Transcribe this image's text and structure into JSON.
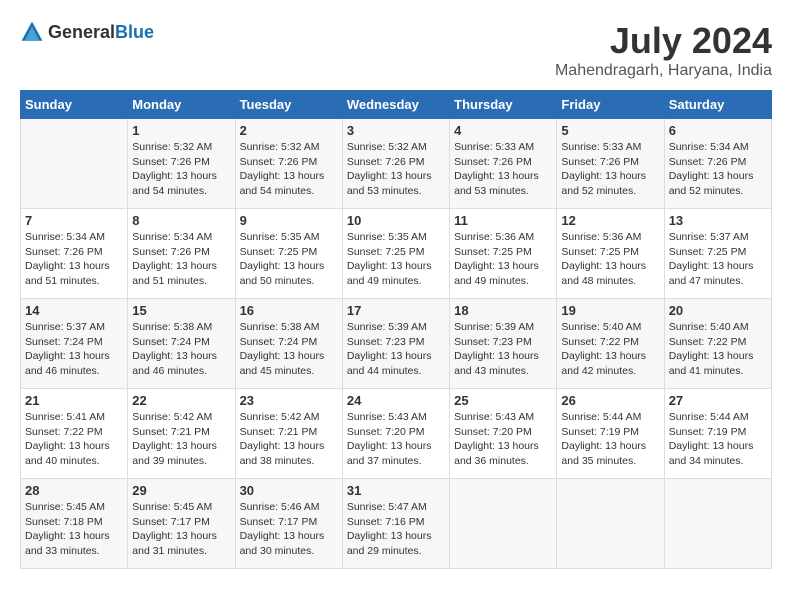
{
  "header": {
    "logo_general": "General",
    "logo_blue": "Blue",
    "month_year": "July 2024",
    "location": "Mahendragarh, Haryana, India"
  },
  "weekdays": [
    "Sunday",
    "Monday",
    "Tuesday",
    "Wednesday",
    "Thursday",
    "Friday",
    "Saturday"
  ],
  "weeks": [
    [
      {
        "day": "",
        "info": ""
      },
      {
        "day": "1",
        "info": "Sunrise: 5:32 AM\nSunset: 7:26 PM\nDaylight: 13 hours\nand 54 minutes."
      },
      {
        "day": "2",
        "info": "Sunrise: 5:32 AM\nSunset: 7:26 PM\nDaylight: 13 hours\nand 54 minutes."
      },
      {
        "day": "3",
        "info": "Sunrise: 5:32 AM\nSunset: 7:26 PM\nDaylight: 13 hours\nand 53 minutes."
      },
      {
        "day": "4",
        "info": "Sunrise: 5:33 AM\nSunset: 7:26 PM\nDaylight: 13 hours\nand 53 minutes."
      },
      {
        "day": "5",
        "info": "Sunrise: 5:33 AM\nSunset: 7:26 PM\nDaylight: 13 hours\nand 52 minutes."
      },
      {
        "day": "6",
        "info": "Sunrise: 5:34 AM\nSunset: 7:26 PM\nDaylight: 13 hours\nand 52 minutes."
      }
    ],
    [
      {
        "day": "7",
        "info": "Sunrise: 5:34 AM\nSunset: 7:26 PM\nDaylight: 13 hours\nand 51 minutes."
      },
      {
        "day": "8",
        "info": "Sunrise: 5:34 AM\nSunset: 7:26 PM\nDaylight: 13 hours\nand 51 minutes."
      },
      {
        "day": "9",
        "info": "Sunrise: 5:35 AM\nSunset: 7:25 PM\nDaylight: 13 hours\nand 50 minutes."
      },
      {
        "day": "10",
        "info": "Sunrise: 5:35 AM\nSunset: 7:25 PM\nDaylight: 13 hours\nand 49 minutes."
      },
      {
        "day": "11",
        "info": "Sunrise: 5:36 AM\nSunset: 7:25 PM\nDaylight: 13 hours\nand 49 minutes."
      },
      {
        "day": "12",
        "info": "Sunrise: 5:36 AM\nSunset: 7:25 PM\nDaylight: 13 hours\nand 48 minutes."
      },
      {
        "day": "13",
        "info": "Sunrise: 5:37 AM\nSunset: 7:25 PM\nDaylight: 13 hours\nand 47 minutes."
      }
    ],
    [
      {
        "day": "14",
        "info": "Sunrise: 5:37 AM\nSunset: 7:24 PM\nDaylight: 13 hours\nand 46 minutes."
      },
      {
        "day": "15",
        "info": "Sunrise: 5:38 AM\nSunset: 7:24 PM\nDaylight: 13 hours\nand 46 minutes."
      },
      {
        "day": "16",
        "info": "Sunrise: 5:38 AM\nSunset: 7:24 PM\nDaylight: 13 hours\nand 45 minutes."
      },
      {
        "day": "17",
        "info": "Sunrise: 5:39 AM\nSunset: 7:23 PM\nDaylight: 13 hours\nand 44 minutes."
      },
      {
        "day": "18",
        "info": "Sunrise: 5:39 AM\nSunset: 7:23 PM\nDaylight: 13 hours\nand 43 minutes."
      },
      {
        "day": "19",
        "info": "Sunrise: 5:40 AM\nSunset: 7:22 PM\nDaylight: 13 hours\nand 42 minutes."
      },
      {
        "day": "20",
        "info": "Sunrise: 5:40 AM\nSunset: 7:22 PM\nDaylight: 13 hours\nand 41 minutes."
      }
    ],
    [
      {
        "day": "21",
        "info": "Sunrise: 5:41 AM\nSunset: 7:22 PM\nDaylight: 13 hours\nand 40 minutes."
      },
      {
        "day": "22",
        "info": "Sunrise: 5:42 AM\nSunset: 7:21 PM\nDaylight: 13 hours\nand 39 minutes."
      },
      {
        "day": "23",
        "info": "Sunrise: 5:42 AM\nSunset: 7:21 PM\nDaylight: 13 hours\nand 38 minutes."
      },
      {
        "day": "24",
        "info": "Sunrise: 5:43 AM\nSunset: 7:20 PM\nDaylight: 13 hours\nand 37 minutes."
      },
      {
        "day": "25",
        "info": "Sunrise: 5:43 AM\nSunset: 7:20 PM\nDaylight: 13 hours\nand 36 minutes."
      },
      {
        "day": "26",
        "info": "Sunrise: 5:44 AM\nSunset: 7:19 PM\nDaylight: 13 hours\nand 35 minutes."
      },
      {
        "day": "27",
        "info": "Sunrise: 5:44 AM\nSunset: 7:19 PM\nDaylight: 13 hours\nand 34 minutes."
      }
    ],
    [
      {
        "day": "28",
        "info": "Sunrise: 5:45 AM\nSunset: 7:18 PM\nDaylight: 13 hours\nand 33 minutes."
      },
      {
        "day": "29",
        "info": "Sunrise: 5:45 AM\nSunset: 7:17 PM\nDaylight: 13 hours\nand 31 minutes."
      },
      {
        "day": "30",
        "info": "Sunrise: 5:46 AM\nSunset: 7:17 PM\nDaylight: 13 hours\nand 30 minutes."
      },
      {
        "day": "31",
        "info": "Sunrise: 5:47 AM\nSunset: 7:16 PM\nDaylight: 13 hours\nand 29 minutes."
      },
      {
        "day": "",
        "info": ""
      },
      {
        "day": "",
        "info": ""
      },
      {
        "day": "",
        "info": ""
      }
    ]
  ]
}
